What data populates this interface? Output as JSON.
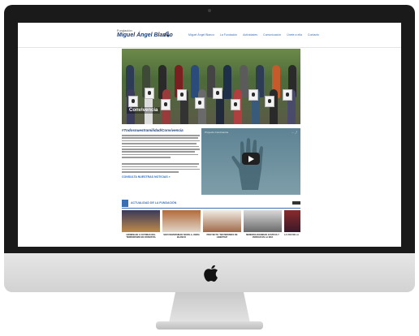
{
  "site": {
    "logo_top": "Fundación",
    "logo_main": "Miguel Ángel Blanco",
    "nav": [
      "Miguel Ángel Blanco",
      "La Fundación",
      "Actividades",
      "Comunicación",
      "Únete a ella",
      "Contacto"
    ],
    "hero_caption": "Convivencia",
    "section_heading": "#Todosnuestramilidad/Convivencia",
    "more_link": "CONSULTA NUESTRAS NOTICIAS »",
    "video_title": "Proyecto Convivencia",
    "news_title": "ACTUALIDAD DE LA FUNDACIÓN",
    "news": [
      {
        "caption": "HOMENAJE A VICTIMAS DEL TERRORISMO EN DONOSTIA"
      },
      {
        "caption": "SER UNIVERSIDAD NOVELA, OBRA BLANCO"
      },
      {
        "caption": "PROYECTO 'TESTIMONIOS DE LIBERTAD'"
      },
      {
        "caption": "MEMORIA DIGNIDAD JUSTICIA Y VERDAD EN LA ERA"
      },
      {
        "caption": "LA VOZ DE LA"
      }
    ]
  },
  "colors": {
    "accent": "#3a6fb5",
    "brand": "#1d3f78"
  }
}
